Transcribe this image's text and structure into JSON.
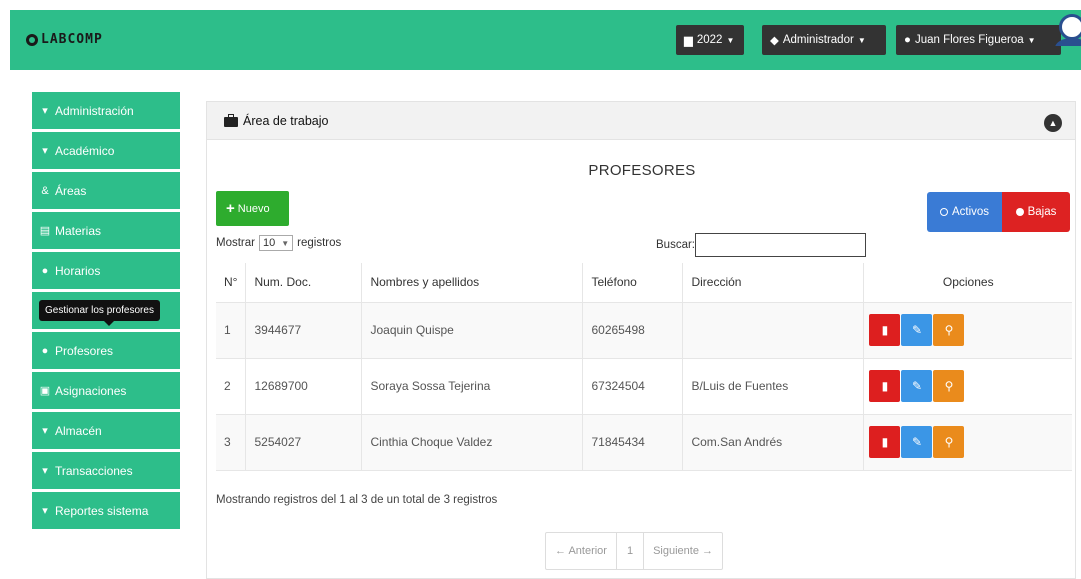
{
  "navbar": {
    "brand": "LABCOMP",
    "year_label": "2022",
    "role_label": "Administrador",
    "user_label": "Juan Flores Figueroa",
    "color": "#2dbe8a"
  },
  "sidebar": {
    "items": [
      {
        "label": "Administración",
        "icon": "chevron-down-icon"
      },
      {
        "label": "Académico",
        "icon": "chevron-down-icon"
      },
      {
        "label": "Áreas",
        "icon": "ampersand-icon"
      },
      {
        "label": "Materias",
        "icon": "book-icon"
      },
      {
        "label": "Horarios",
        "icon": "clock-icon"
      },
      {
        "label": "Profesores",
        "icon": "user-icon"
      },
      {
        "label": "Asignaciones",
        "icon": "clipboard-icon"
      },
      {
        "label": "Almacén",
        "icon": "chevron-down-icon"
      },
      {
        "label": "Transacciones",
        "icon": "chevron-down-icon"
      },
      {
        "label": "Reportes sistema",
        "icon": "chevron-down-icon"
      }
    ],
    "tooltip": "Gestionar los profesores"
  },
  "panel": {
    "title": "Área de trabajo",
    "page_title": "PROFESORES",
    "new_button": "Nuevo",
    "activos_label": "Activos",
    "bajas_label": "Bajas",
    "length_prefix": "Mostrar",
    "length_value": "10",
    "length_suffix": "registros",
    "search_label": "Buscar:",
    "search_value": ""
  },
  "table": {
    "headers": [
      "N°",
      "Num. Doc.",
      "Nombres y apellidos",
      "Teléfono",
      "Dirección",
      "Opciones"
    ],
    "rows": [
      {
        "n": "1",
        "doc": "3944677",
        "name": "Joaquin Quispe",
        "tel": "60265498",
        "dir": ""
      },
      {
        "n": "2",
        "doc": "12689700",
        "name": "Soraya Sossa Tejerina",
        "tel": "67324504",
        "dir": "B/Luis de Fuentes"
      },
      {
        "n": "3",
        "doc": "5254027",
        "name": "Cinthia Choque Valdez",
        "tel": "71845434",
        "dir": "Com.San Andrés"
      }
    ]
  },
  "footer": {
    "info": "Mostrando registros del 1 al 3 de un total de 3 registros",
    "prev": "← Anterior",
    "page": "1",
    "next": "Siguiente →"
  }
}
